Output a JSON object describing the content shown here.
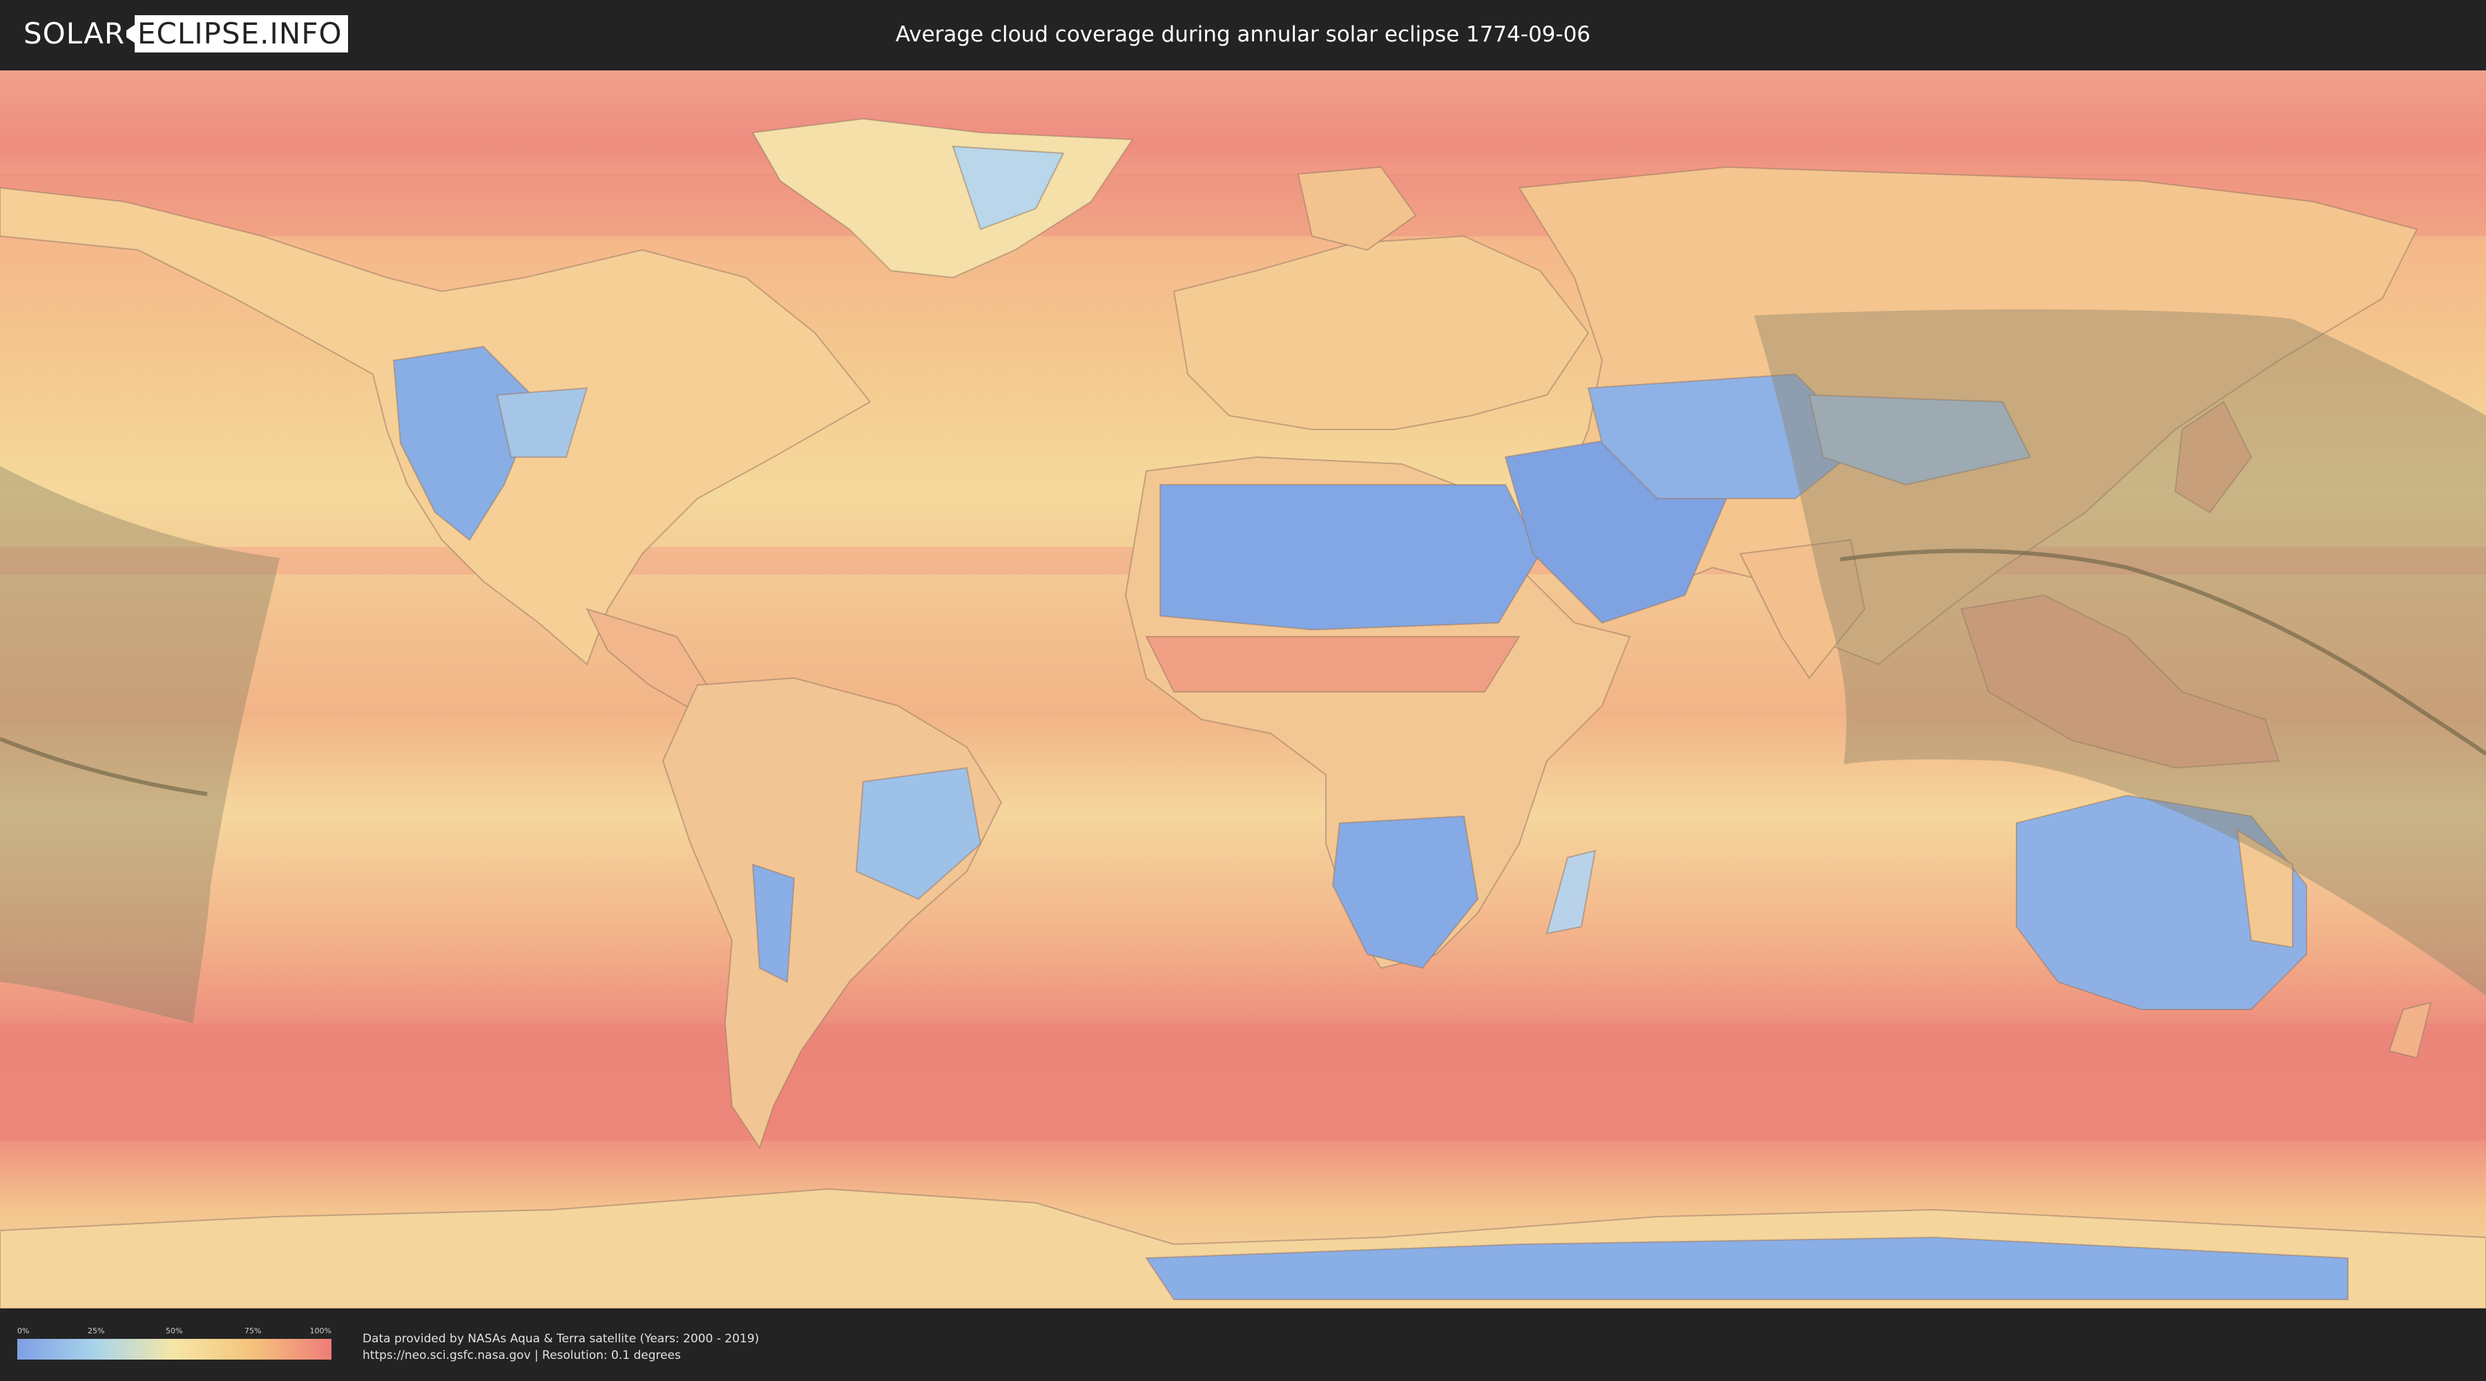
{
  "header": {
    "logo_solar": "SOLAR",
    "logo_eclipse": "ECLIPSE.INFO",
    "title": "Average cloud coverage during annular solar eclipse 1774-09-06"
  },
  "map": {
    "colors": {
      "background_gray": "#6a6a6a",
      "cloud_low": "#7f9fe4",
      "cloud_25": "#a9d4ea",
      "cloud_50": "#f5e6a6",
      "cloud_75": "#f5c27c",
      "cloud_high": "#ee7d7a",
      "eclipse_path_shade": "#8c8466",
      "central_line": "#6e6447"
    }
  },
  "legend": {
    "ticks": [
      "0%",
      "25%",
      "50%",
      "75%",
      "100%"
    ]
  },
  "footer": {
    "credit_line1": "Data provided by NASAs Aqua & Terra satellite (Years: 2000 - 2019)",
    "credit_line2": "https://neo.sci.gsfc.nasa.gov | Resolution: 0.1 degrees"
  }
}
